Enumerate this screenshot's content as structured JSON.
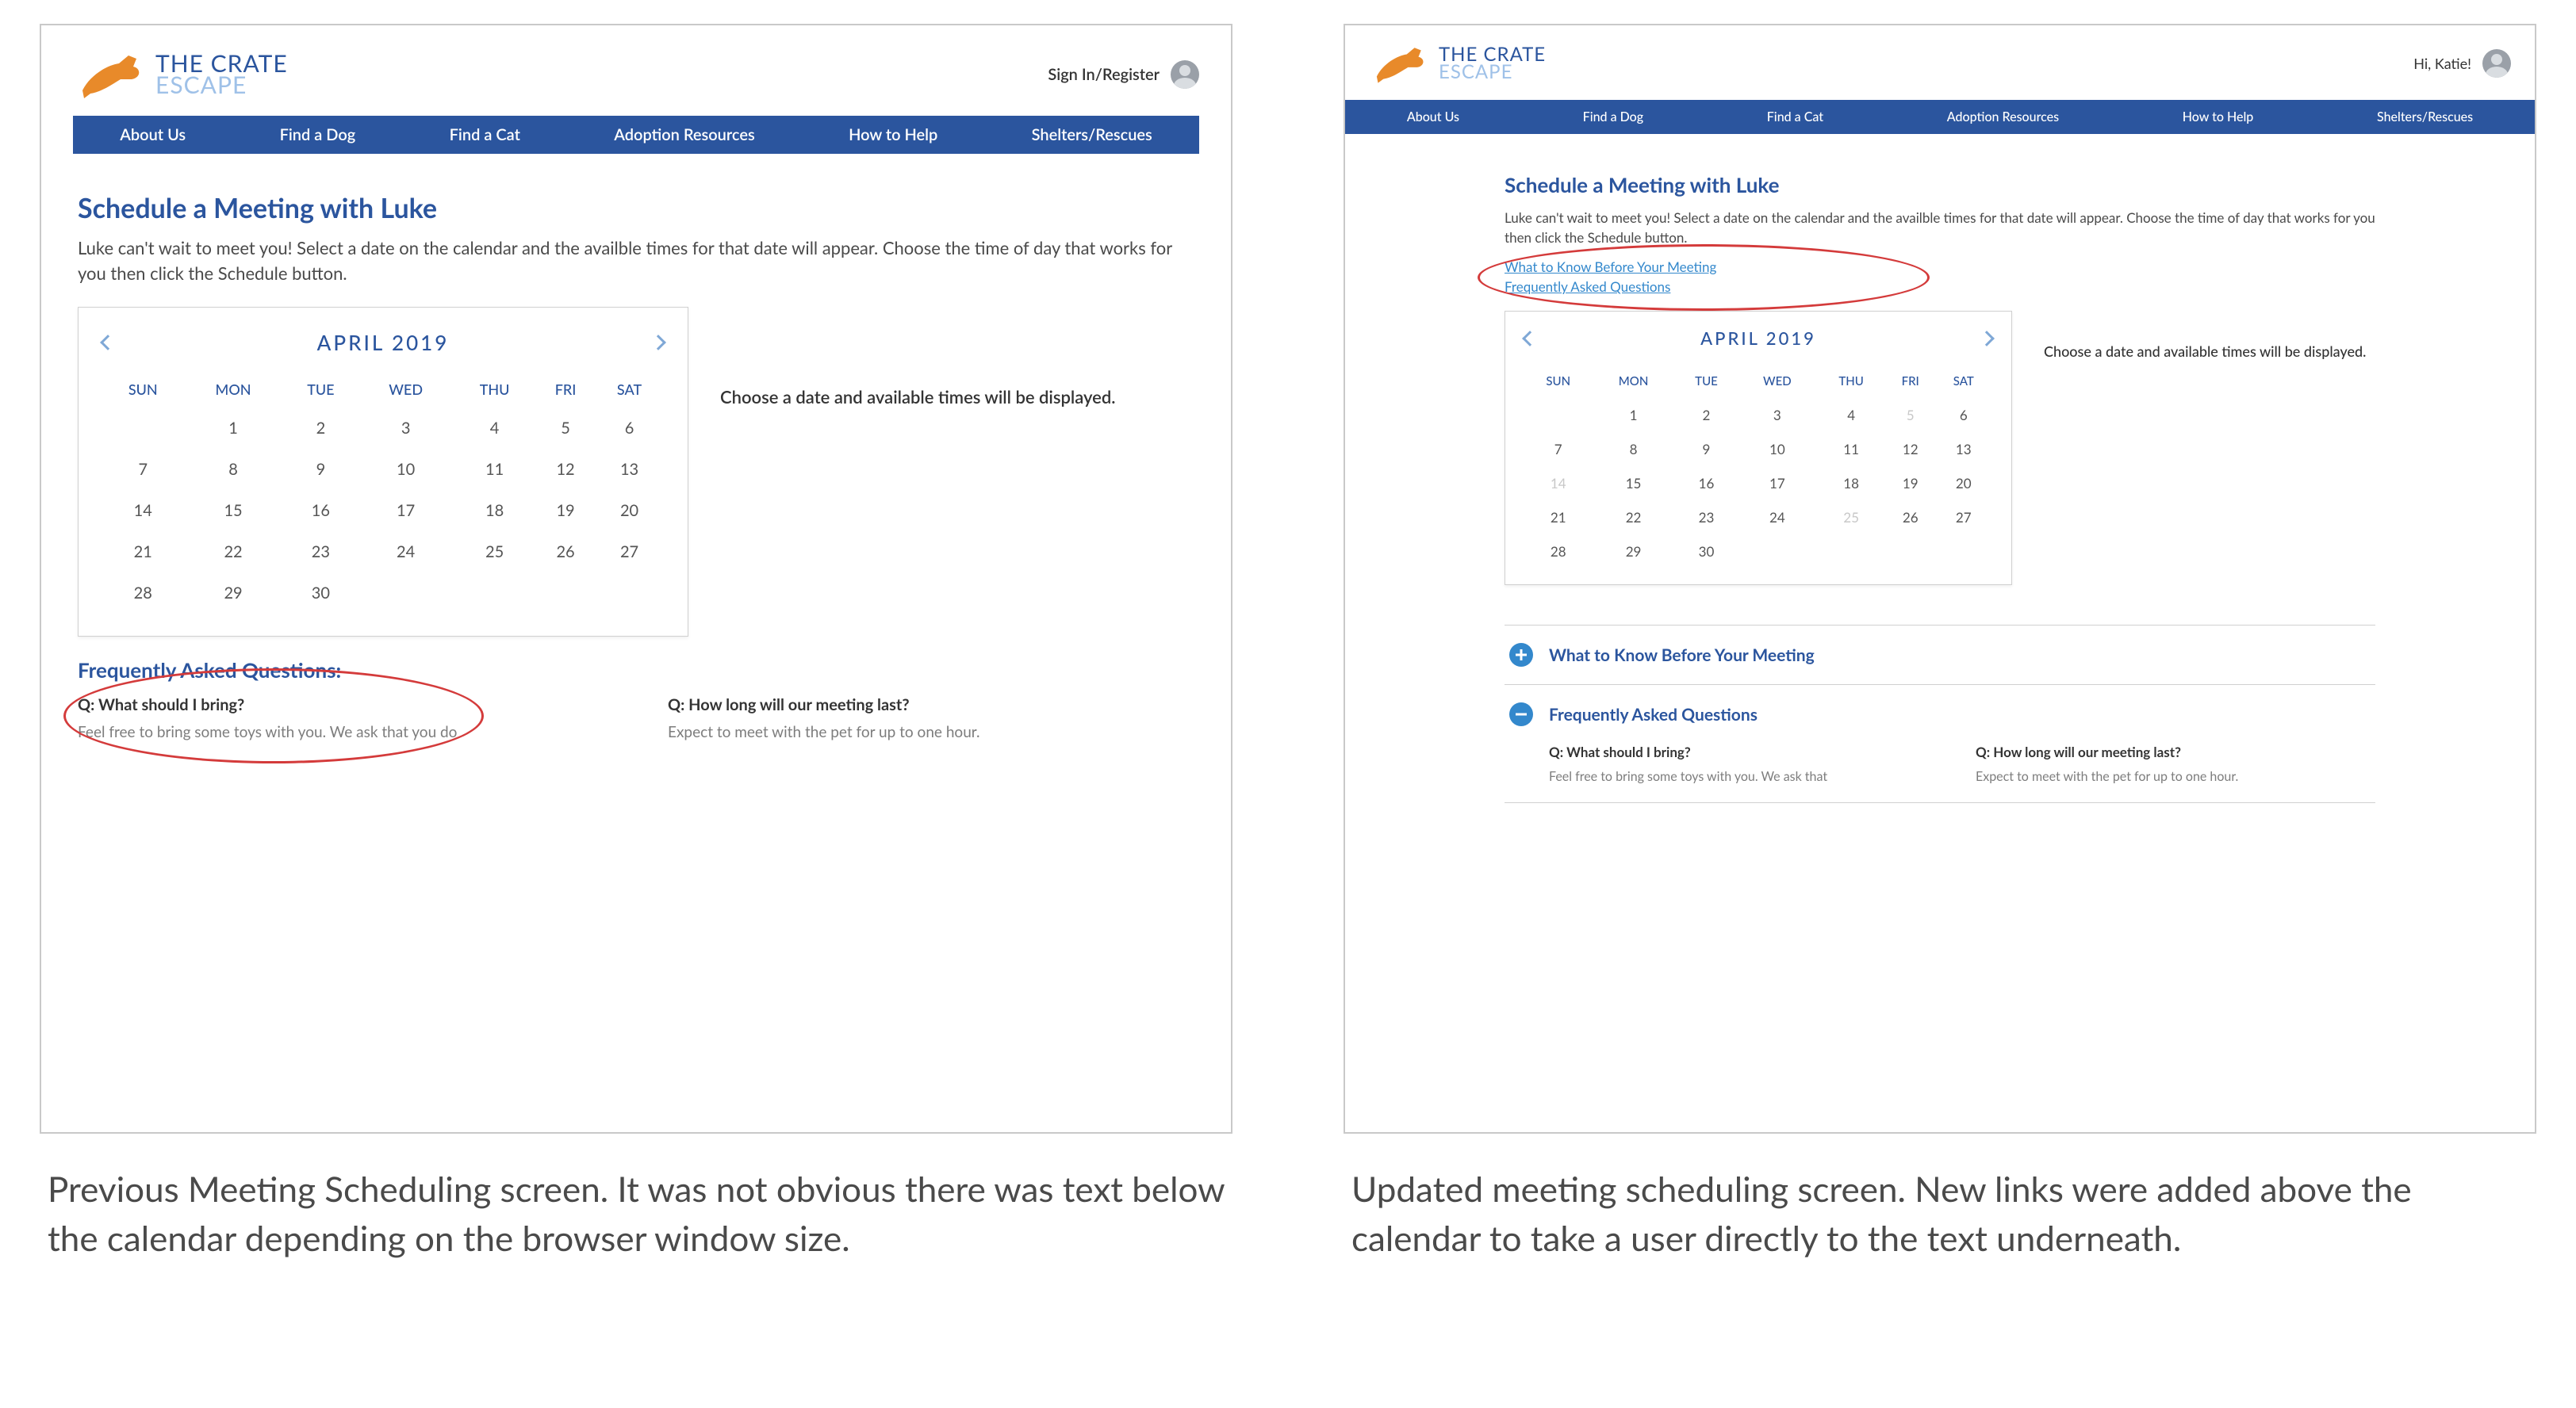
{
  "brand": {
    "line1": "THE CRATE",
    "line2": "ESCAPE"
  },
  "nav": [
    "About Us",
    "Find a Dog",
    "Find a Cat",
    "Adoption Resources",
    "How to Help",
    "Shelters/Rescues"
  ],
  "left": {
    "account_label": "Sign In/Register",
    "title": "Schedule a Meeting with Luke",
    "intro": "Luke can't wait to meet you! Select a date on the calendar and the availble times for that date will appear. Choose the time of day that works for you then click the Schedule button.",
    "cal_month": "APRIL 2019",
    "availability_msg": "Choose a date and available times will be displayed.",
    "faq_heading": "Frequently Asked Questions:",
    "faq": [
      {
        "q": "Q: What should I bring?",
        "a": "Feel free to bring some toys with you. We ask that you do"
      },
      {
        "q": "Q: How long will our meeting last?",
        "a": "Expect to meet with the pet for up to one hour."
      }
    ],
    "caption": "Previous Meeting Scheduling screen. It was not obvious there was text below the calendar depending on the browser window size."
  },
  "right": {
    "account_label": "Hi, Katie!",
    "title": "Schedule a Meeting with Luke",
    "intro": "Luke can't wait to meet you! Select a date on the calendar and the availble times for that date will appear. Choose the time of day that works for you then click the Schedule button.",
    "anchor1": "What to Know Before Your Meeting",
    "anchor2": "Frequently Asked Questions",
    "cal_month": "APRIL 2019",
    "availability_msg": "Choose a date and available times will be displayed.",
    "acc": [
      {
        "title": "What to Know Before Your Meeting",
        "expanded": false
      },
      {
        "title": "Frequently Asked Questions",
        "expanded": true,
        "faq": [
          {
            "q": "Q: What should I bring?",
            "a": "Feel free to bring some toys with you. We ask that"
          },
          {
            "q": "Q: How long will our meeting last?",
            "a": "Expect to meet with the pet for up to one hour."
          }
        ]
      }
    ],
    "caption": "Updated meeting scheduling screen. New links were added above the calendar to take a user directly to the text underneath."
  },
  "calendar": {
    "days": [
      "SUN",
      "MON",
      "TUE",
      "WED",
      "THU",
      "FRI",
      "SAT"
    ],
    "weeks": [
      [
        "",
        "1",
        "2",
        "3",
        "4",
        "5",
        "6"
      ],
      [
        "7",
        "8",
        "9",
        "10",
        "11",
        "12",
        "13"
      ],
      [
        "14",
        "15",
        "16",
        "17",
        "18",
        "19",
        "20"
      ],
      [
        "21",
        "22",
        "23",
        "24",
        "25",
        "26",
        "27"
      ],
      [
        "28",
        "29",
        "30",
        "",
        "",
        "",
        ""
      ]
    ]
  },
  "right_muted": [
    "5",
    "14",
    "25"
  ]
}
